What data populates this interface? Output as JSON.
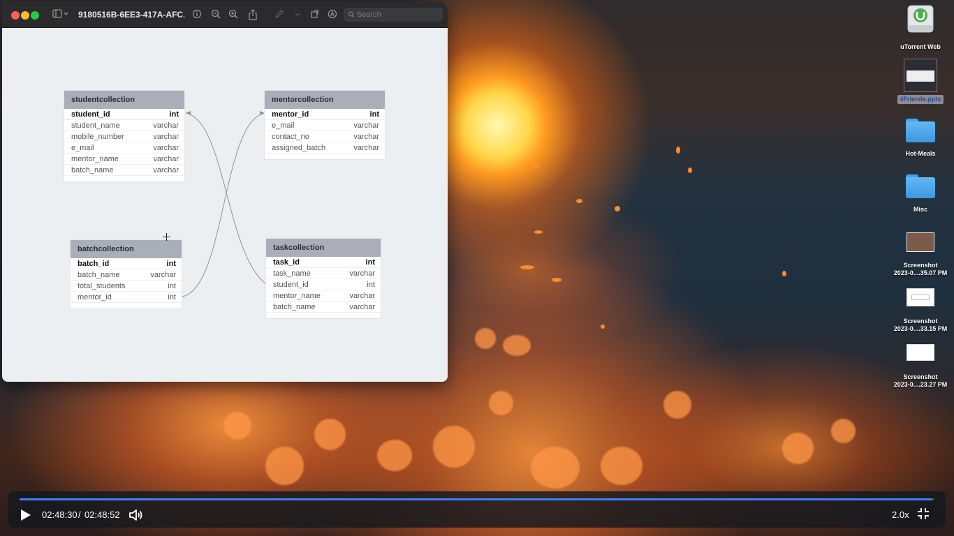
{
  "window": {
    "title": "9180516B-6EE3-417A-AFC...",
    "search_placeholder": "Search"
  },
  "tables": {
    "studentcollection": {
      "name": "studentcollection",
      "columns": [
        {
          "name": "student_id",
          "type": "int"
        },
        {
          "name": "student_name",
          "type": "varchar"
        },
        {
          "name": "mobile_number",
          "type": "varchar"
        },
        {
          "name": "e_mail",
          "type": "varchar"
        },
        {
          "name": "mentor_name",
          "type": "varchar"
        },
        {
          "name": "batch_name",
          "type": "varchar"
        }
      ]
    },
    "mentorcollection": {
      "name": "mentorcollection",
      "columns": [
        {
          "name": "mentor_id",
          "type": "int"
        },
        {
          "name": "e_mail",
          "type": "varchar"
        },
        {
          "name": "contact_no",
          "type": "varchar"
        },
        {
          "name": "assigned_batch",
          "type": "varchar"
        }
      ]
    },
    "batchcollection": {
      "name": "batchcollection",
      "columns": [
        {
          "name": "batch_id",
          "type": "int"
        },
        {
          "name": "batch_name",
          "type": "varchar"
        },
        {
          "name": "total_students",
          "type": "int"
        },
        {
          "name": "mentor_id",
          "type": "int"
        }
      ]
    },
    "taskcollection": {
      "name": "taskcollection",
      "columns": [
        {
          "name": "task_id",
          "type": "int"
        },
        {
          "name": "task_name",
          "type": "varchar"
        },
        {
          "name": "student_id",
          "type": "int"
        },
        {
          "name": "mentor_name",
          "type": "varchar"
        },
        {
          "name": "batch_name",
          "type": "varchar"
        }
      ]
    }
  },
  "desktop": {
    "items": [
      {
        "label": "uTorrent Web",
        "icon": "utorrent-drive-icon"
      },
      {
        "label": "4Friends.pptx",
        "icon": "pptx-thumbnail-icon"
      },
      {
        "label": "Hot-Meals",
        "icon": "folder-icon"
      },
      {
        "label": "Misc",
        "icon": "folder-icon"
      },
      {
        "label": "Screenshot",
        "label2": "2023-0....35.07 PM",
        "icon": "screenshot-thumbnail-icon"
      },
      {
        "label": "Screenshot",
        "label2": "2023-0....33.15 PM",
        "icon": "screenshot-thumbnail-icon"
      },
      {
        "label": "Screenshot",
        "label2": "2023-0....23.27 PM",
        "icon": "screenshot-thumbnail-icon"
      }
    ]
  },
  "player": {
    "current_time": "02:48:30",
    "separator": "/",
    "total_time": "02:48:52",
    "speed": "2.0x",
    "progress": 0.998
  },
  "colors": {
    "accent": "#3b82f6",
    "table_header": "#a9aeb8"
  }
}
